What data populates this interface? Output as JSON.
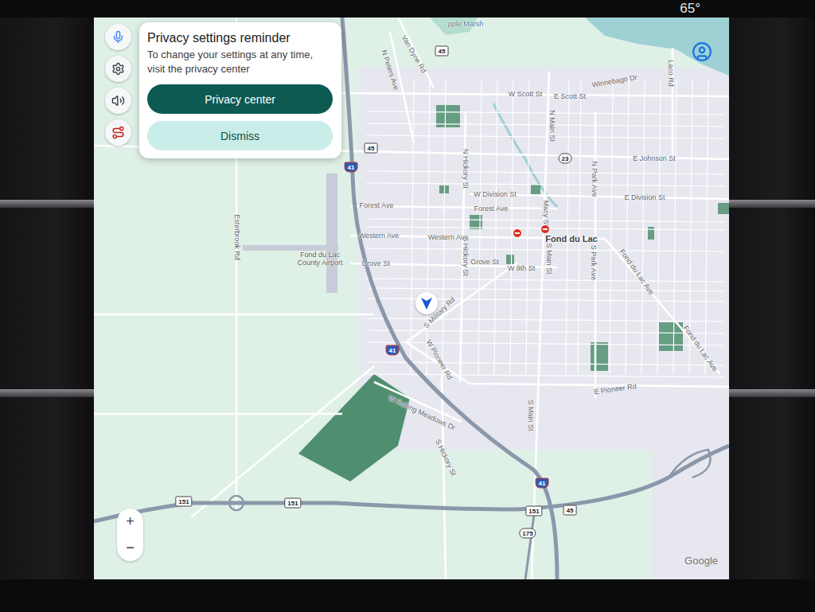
{
  "status": {
    "temperature": "65°"
  },
  "popup": {
    "title": "Privacy settings reminder",
    "message": "To change your settings at any time, visit the privacy center",
    "primary_button": "Privacy center",
    "secondary_button": "Dismiss"
  },
  "map": {
    "labels": [
      {
        "text": "pple Marsh",
        "kind": "water"
      },
      {
        "text": "N Peters Ave",
        "kind": "street"
      },
      {
        "text": "Van Dyne Rd",
        "kind": "street"
      },
      {
        "text": "W Scott St",
        "kind": "street"
      },
      {
        "text": "E Scott St",
        "kind": "street"
      },
      {
        "text": "Winnebago Dr",
        "kind": "street"
      },
      {
        "text": "Laco Rd",
        "kind": "street"
      },
      {
        "text": "N Main St",
        "kind": "street"
      },
      {
        "text": "E Johnson St",
        "kind": "street"
      },
      {
        "text": "N Hickory St",
        "kind": "street"
      },
      {
        "text": "N Park Ave",
        "kind": "street"
      },
      {
        "text": "W Division St",
        "kind": "street"
      },
      {
        "text": "E Division St",
        "kind": "street"
      },
      {
        "text": "Forest Ave",
        "kind": "street"
      },
      {
        "text": "Forest Ave",
        "kind": "street"
      },
      {
        "text": "Macy St",
        "kind": "street"
      },
      {
        "text": "Western Ave",
        "kind": "street"
      },
      {
        "text": "Western Ave",
        "kind": "street"
      },
      {
        "text": "Fond du Lac",
        "kind": "city"
      },
      {
        "text": "Esterbrook Rd",
        "kind": "street"
      },
      {
        "text": "Fond du Lac County Airport",
        "kind": "airport"
      },
      {
        "text": "Grove St",
        "kind": "street"
      },
      {
        "text": "Grove St",
        "kind": "street"
      },
      {
        "text": "W 9th St",
        "kind": "street"
      },
      {
        "text": "S Hickory St",
        "kind": "street"
      },
      {
        "text": "S Main St",
        "kind": "street"
      },
      {
        "text": "S Park Ave",
        "kind": "street"
      },
      {
        "text": "Fond du Lac Ave",
        "kind": "street"
      },
      {
        "text": "Fond du Lac Ave",
        "kind": "street"
      },
      {
        "text": "S Military Rd",
        "kind": "street"
      },
      {
        "text": "W Pioneer Rd",
        "kind": "street"
      },
      {
        "text": "E Pioneer Rd",
        "kind": "street"
      },
      {
        "text": "W Rolling Meadows Dr",
        "kind": "street"
      },
      {
        "text": "S Hickory St",
        "kind": "street"
      },
      {
        "text": "S Main St",
        "kind": "street"
      }
    ],
    "shields": [
      {
        "text": "41",
        "kind": "interstate"
      },
      {
        "text": "41",
        "kind": "interstate"
      },
      {
        "text": "41",
        "kind": "interstate"
      },
      {
        "text": "45",
        "kind": "us"
      },
      {
        "text": "45",
        "kind": "us"
      },
      {
        "text": "45",
        "kind": "us"
      },
      {
        "text": "23",
        "kind": "state"
      },
      {
        "text": "151",
        "kind": "us"
      },
      {
        "text": "151",
        "kind": "us"
      },
      {
        "text": "151",
        "kind": "us"
      },
      {
        "text": "175",
        "kind": "state"
      }
    ],
    "attribution": "Google"
  },
  "zoom": {
    "in": "+",
    "out": "−"
  }
}
